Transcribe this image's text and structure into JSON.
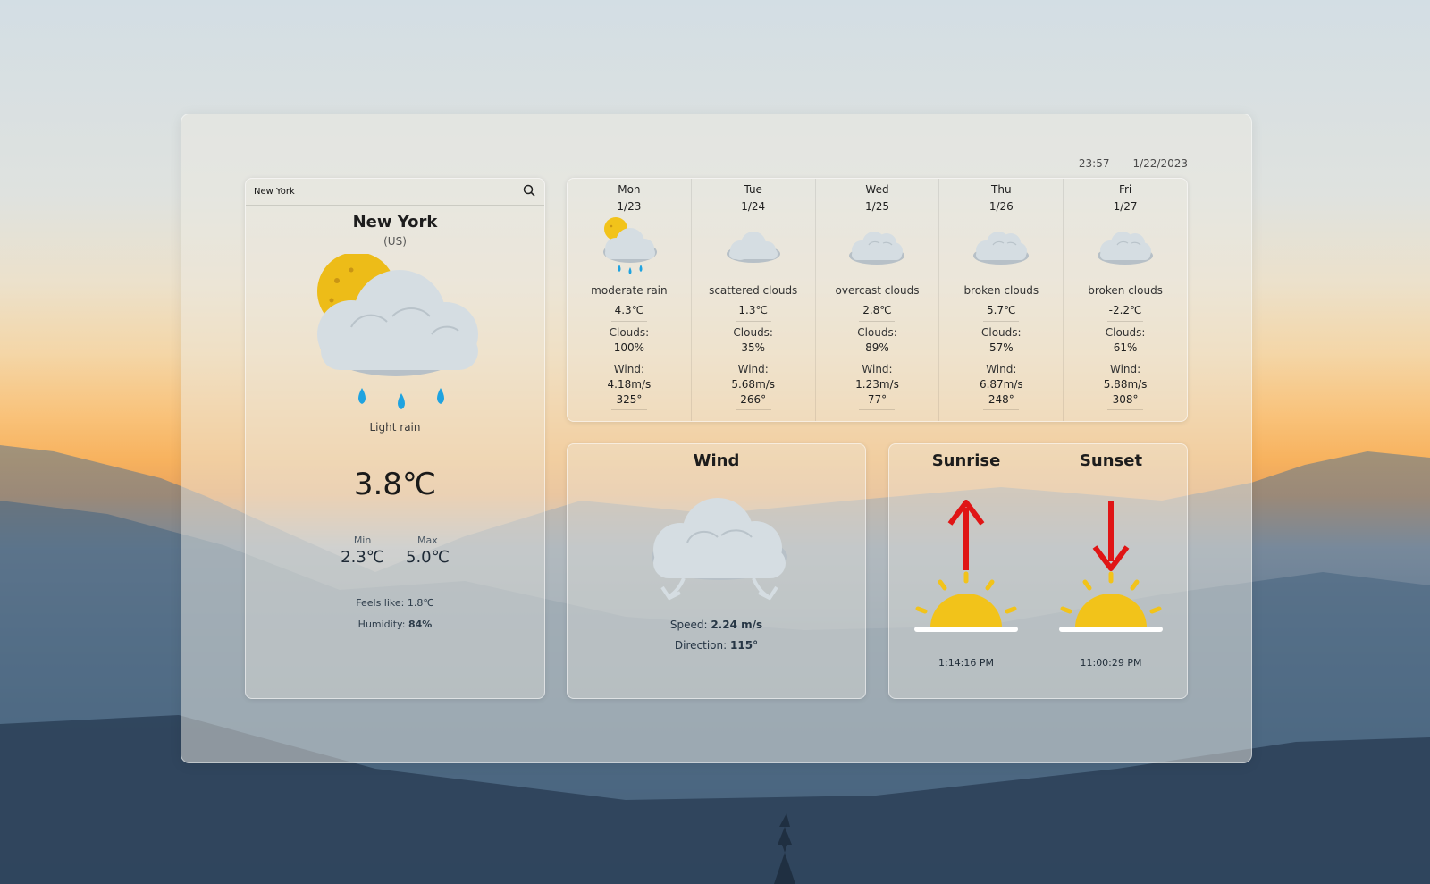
{
  "header": {
    "time": "23:57",
    "date": "1/22/2023"
  },
  "search": {
    "value": "New York",
    "icon": "search-icon"
  },
  "current": {
    "city": "New York",
    "country": "(US)",
    "icon": "sun-cloud-rain-icon",
    "description": "Light rain",
    "temperature": "3.8℃",
    "min_label": "Min",
    "min_value": "2.3℃",
    "max_label": "Max",
    "max_value": "5.0℃",
    "feels_like_label": "Feels like:",
    "feels_like_value": "1.8℃",
    "humidity_label": "Humidity:",
    "humidity_value": "84%"
  },
  "forecast": [
    {
      "day": "Mon",
      "date": "1/23",
      "icon": "sun-cloud-rain-icon",
      "description": "moderate rain",
      "temp": "4.3℃",
      "clouds_label": "Clouds:",
      "clouds": "100%",
      "wind_label": "Wind:",
      "wind_speed": "4.18m/s",
      "wind_dir": "325°"
    },
    {
      "day": "Tue",
      "date": "1/24",
      "icon": "cloud-icon",
      "description": "scattered clouds",
      "temp": "1.3℃",
      "clouds_label": "Clouds:",
      "clouds": "35%",
      "wind_label": "Wind:",
      "wind_speed": "5.68m/s",
      "wind_dir": "266°"
    },
    {
      "day": "Wed",
      "date": "1/25",
      "icon": "double-cloud-icon",
      "description": "overcast clouds",
      "temp": "2.8℃",
      "clouds_label": "Clouds:",
      "clouds": "89%",
      "wind_label": "Wind:",
      "wind_speed": "1.23m/s",
      "wind_dir": "77°"
    },
    {
      "day": "Thu",
      "date": "1/26",
      "icon": "double-cloud-icon",
      "description": "broken clouds",
      "temp": "5.7℃",
      "clouds_label": "Clouds:",
      "clouds": "57%",
      "wind_label": "Wind:",
      "wind_speed": "6.87m/s",
      "wind_dir": "248°"
    },
    {
      "day": "Fri",
      "date": "1/27",
      "icon": "double-cloud-icon",
      "description": "broken clouds",
      "temp": "-2.2℃",
      "clouds_label": "Clouds:",
      "clouds": "61%",
      "wind_label": "Wind:",
      "wind_speed": "5.88m/s",
      "wind_dir": "308°"
    }
  ],
  "wind": {
    "title": "Wind",
    "icon": "cloud-wind-icon",
    "speed_label": "Speed:",
    "speed_value": "2.24 m/s",
    "direction_label": "Direction:",
    "direction_value": "115°"
  },
  "sun": {
    "sunrise_label": "Sunrise",
    "sunrise_time": "1:14:16 PM",
    "sunset_label": "Sunset",
    "sunset_time": "11:00:29 PM",
    "sunrise_icon": "sunrise-icon",
    "sunset_icon": "sunset-icon"
  },
  "colors": {
    "sun": "#f2c31a",
    "rain": "#1fa3e0",
    "cloud": "#d9e0e5",
    "arrow": "#e01515"
  }
}
